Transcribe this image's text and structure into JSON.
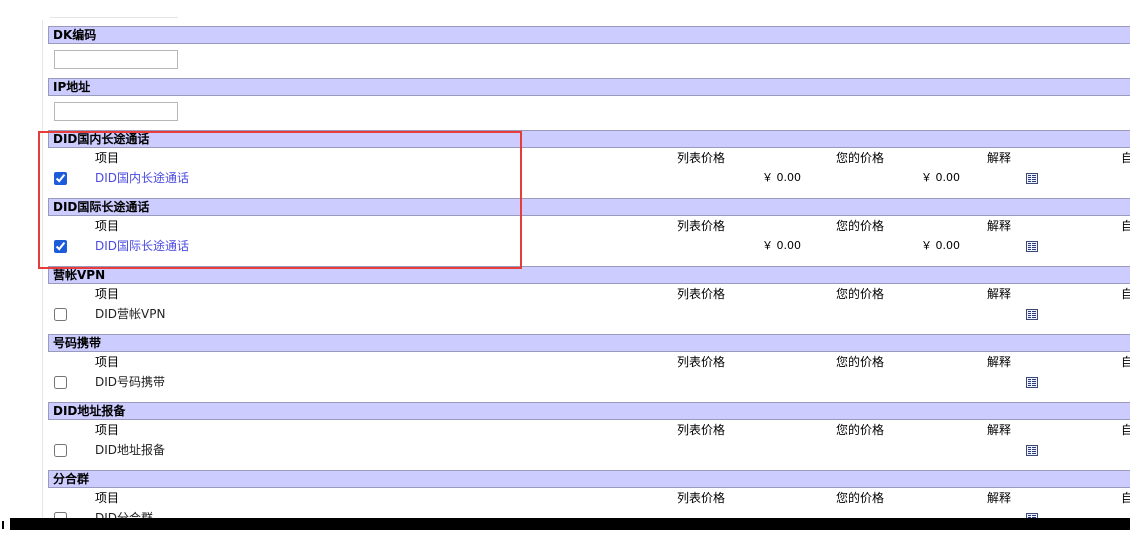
{
  "fields": [
    {
      "label": "DK编码",
      "value": ""
    },
    {
      "label": "IP地址",
      "value": ""
    }
  ],
  "columns": {
    "item": "项目",
    "list_price": "列表价格",
    "your_price": "您的价格",
    "explain": "解释",
    "auto": "自"
  },
  "sections": [
    {
      "title": "DID国内长途通话",
      "item": "DID国内长途通话",
      "checked": true,
      "list_price": "￥ 0.00",
      "your_price": "￥ 0.00"
    },
    {
      "title": "DID国际长途通话",
      "item": "DID国际长途通话",
      "checked": true,
      "list_price": "￥ 0.00",
      "your_price": "￥ 0.00"
    },
    {
      "title": "营帐VPN",
      "item": "DID营帐VPN",
      "checked": false,
      "list_price": "",
      "your_price": ""
    },
    {
      "title": "号码携带",
      "item": "DID号码携带",
      "checked": false,
      "list_price": "",
      "your_price": ""
    },
    {
      "title": "DID地址报备",
      "item": "DID地址报备",
      "checked": false,
      "list_price": "",
      "your_price": ""
    },
    {
      "title": "分合群",
      "item": "DID分合群",
      "checked": false,
      "list_price": "",
      "your_price": ""
    }
  ],
  "colors": {
    "header_bg": "#ccccff",
    "highlight": "#e63c3c",
    "link": "#4c4ce0"
  }
}
